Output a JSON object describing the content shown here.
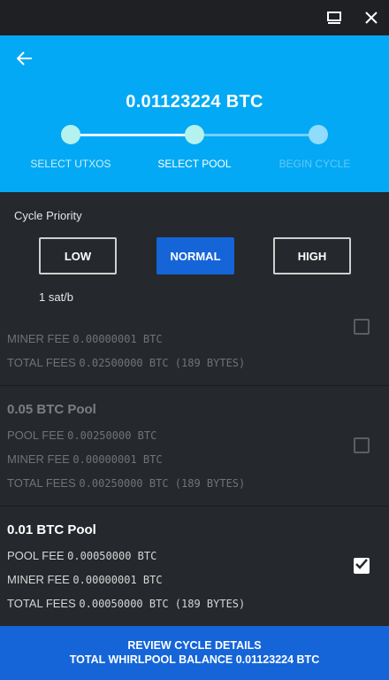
{
  "titlebar": {
    "maximize_icon": "maximize-icon",
    "close_icon": "close-icon"
  },
  "header": {
    "back_icon": "arrow-left-icon",
    "amount": "0.01123224 BTC",
    "steps": [
      {
        "label": "SELECT UTXOS",
        "state": "done"
      },
      {
        "label": "SELECT POOL",
        "state": "current"
      },
      {
        "label": "BEGIN CYCLE",
        "state": "pending"
      }
    ]
  },
  "priority": {
    "title": "Cycle Priority",
    "options": [
      "LOW",
      "NORMAL",
      "HIGH"
    ],
    "selected": "NORMAL",
    "fee_rate": "1 sat/b"
  },
  "pools": [
    {
      "name": "",
      "pool_fee_label": "",
      "pool_fee_value": "",
      "miner_fee_label": "MINER FEE",
      "miner_fee_value": "0.00000001 BTC",
      "total_fees_label": "TOTAL FEES",
      "total_fees_value": "0.02500000 BTC (189 BYTES)",
      "checked": false
    },
    {
      "name": "0.05 BTC Pool",
      "pool_fee_label": "POOL FEE",
      "pool_fee_value": "0.00250000 BTC",
      "miner_fee_label": "MINER FEE",
      "miner_fee_value": "0.00000001 BTC",
      "total_fees_label": "TOTAL FEES",
      "total_fees_value": "0.00250000 BTC (189 BYTES)",
      "checked": false
    },
    {
      "name": "0.01 BTC Pool",
      "pool_fee_label": "POOL FEE",
      "pool_fee_value": "0.00050000 BTC",
      "miner_fee_label": "MINER FEE",
      "miner_fee_value": "0.00000001 BTC",
      "total_fees_label": "TOTAL FEES",
      "total_fees_value": "0.00050000 BTC (189 BYTES)",
      "checked": true
    }
  ],
  "footer": {
    "line1": "REVIEW CYCLE DETAILS",
    "line2": "TOTAL WHIRLPOOL BALANCE 0.01123224 BTC"
  },
  "colors": {
    "header_bg": "#03a9f4",
    "accent_blue": "#1565d8",
    "body_bg": "#25282d"
  }
}
